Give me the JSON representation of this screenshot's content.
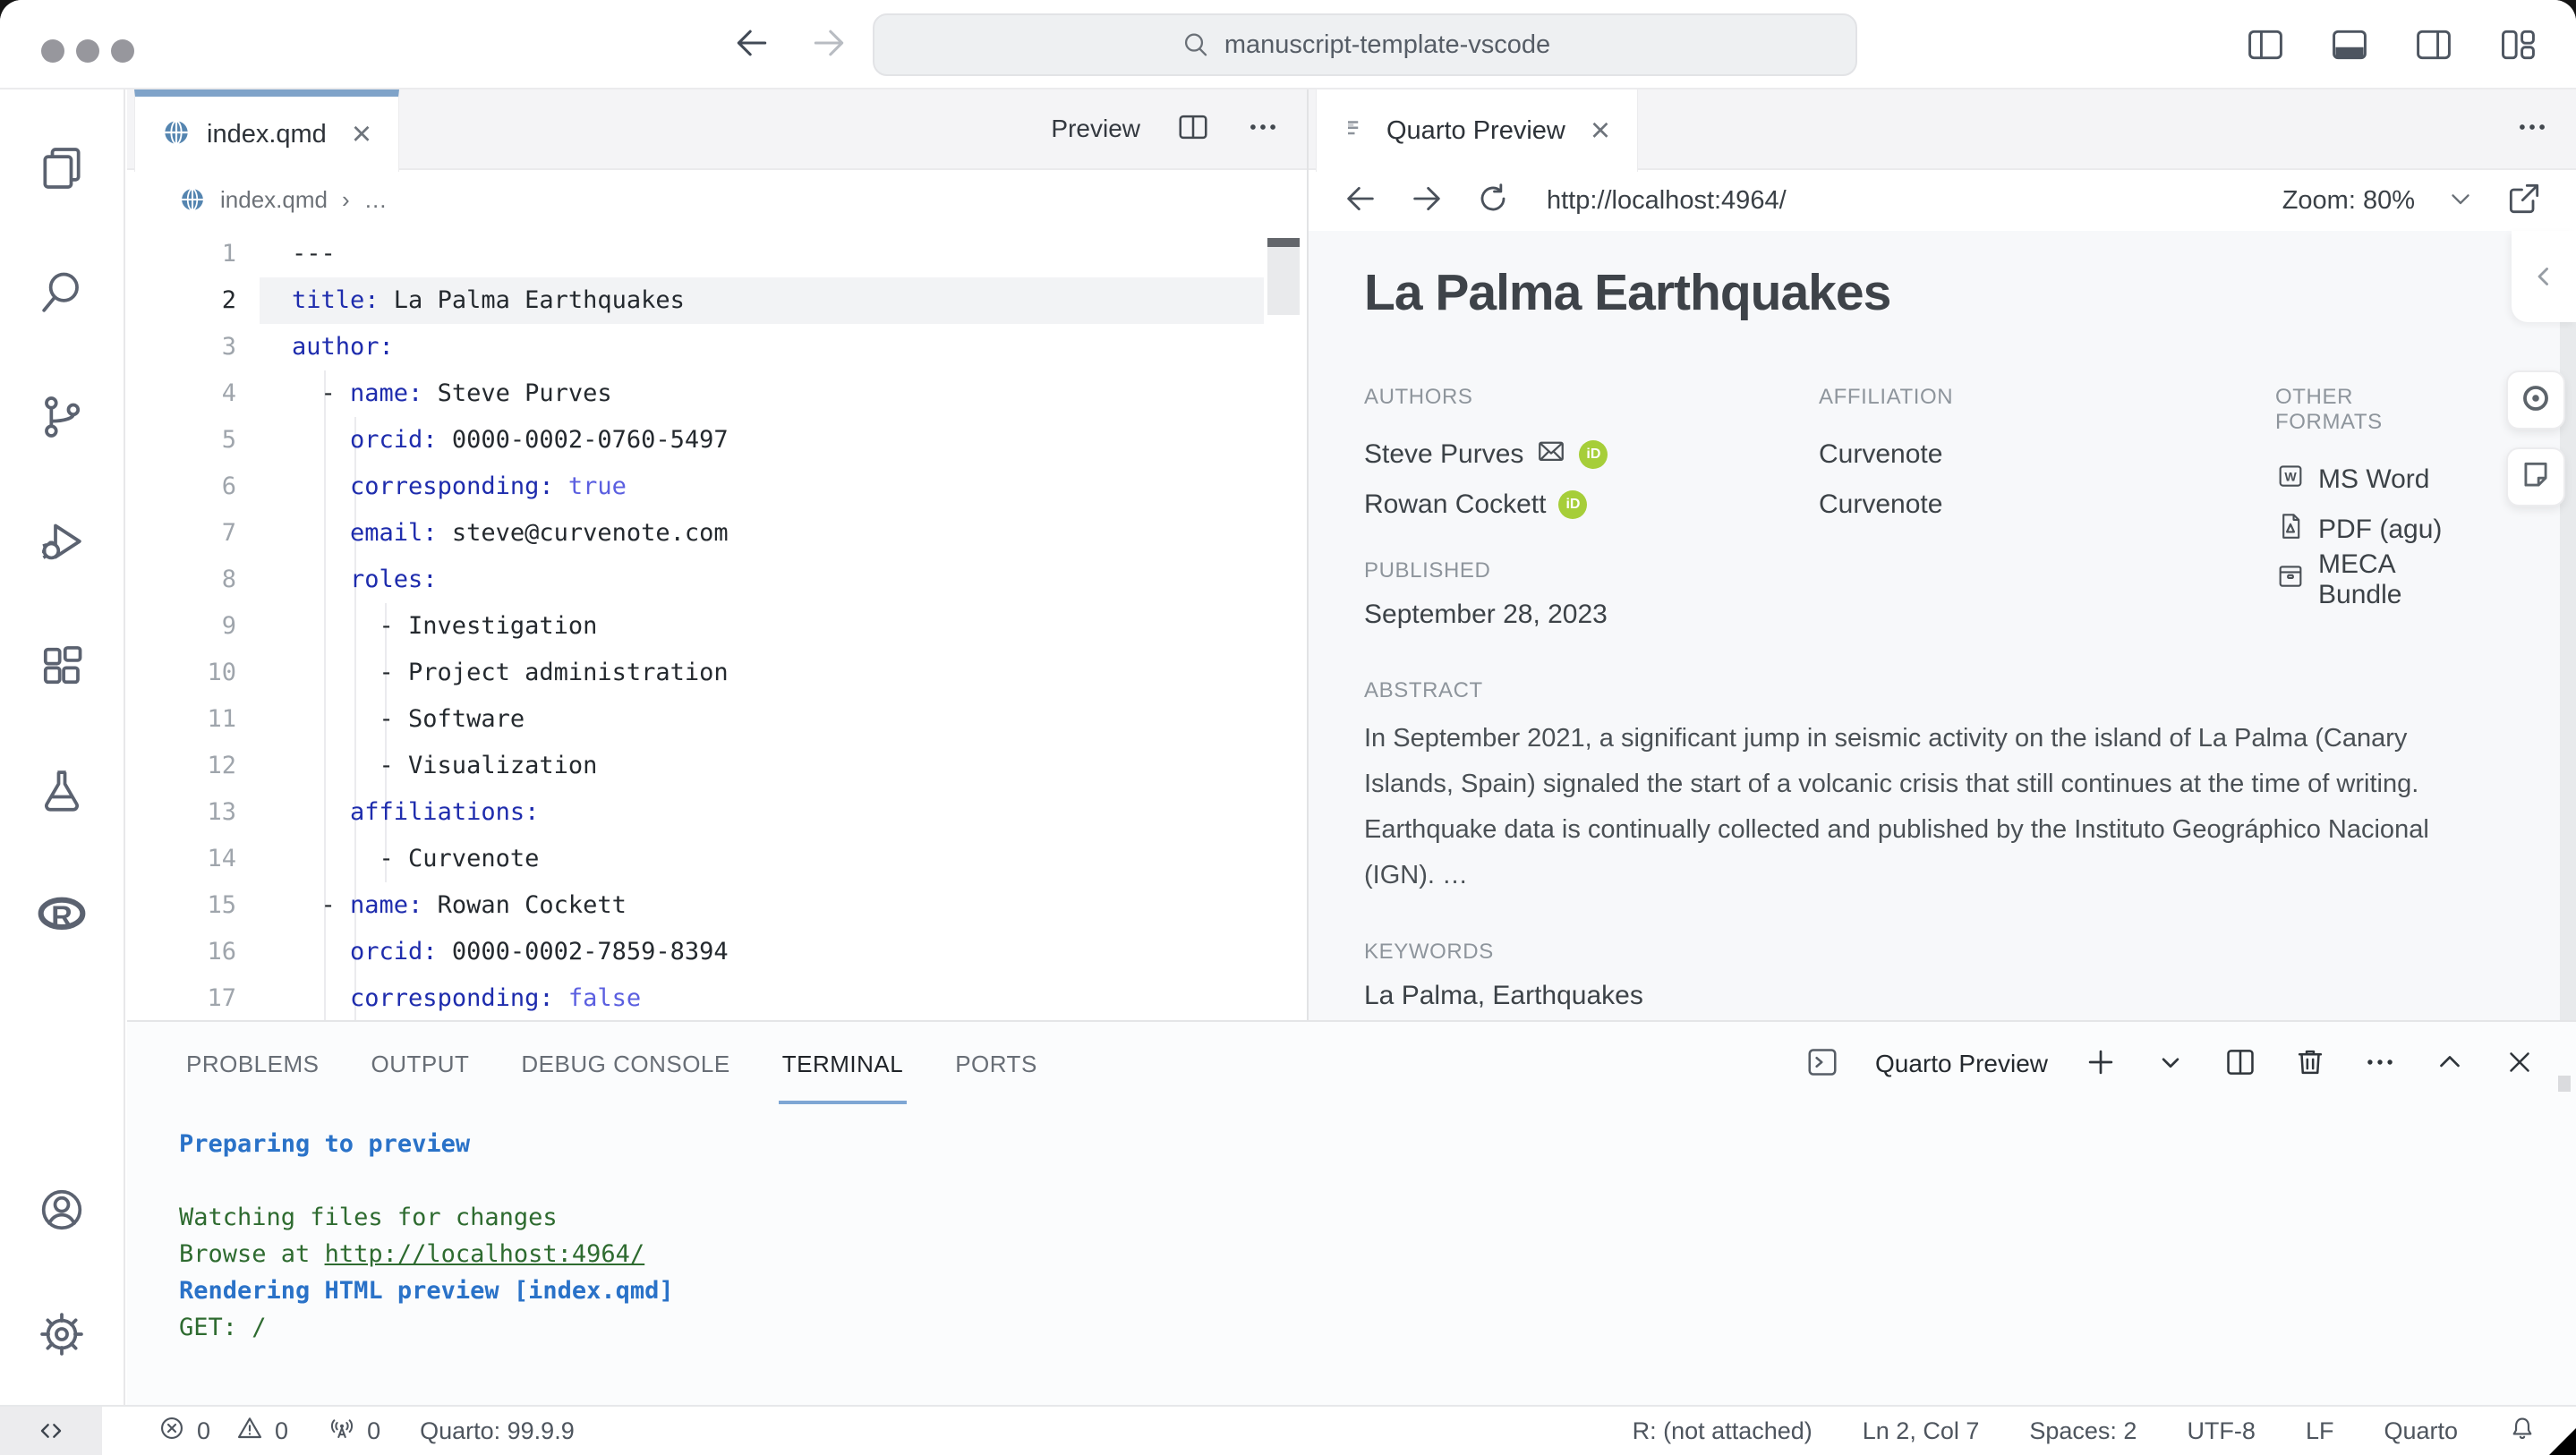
{
  "colors": {
    "accent_tab_top": "#7fa3c9",
    "key_blue": "#1e2cad",
    "bool_blue": "#5b5fe0",
    "terminal_green": "#2e6b30",
    "terminal_blue": "#2a72c8",
    "panel_tab_underline": "#7ea6d4",
    "orcid_green": "#a6ce39"
  },
  "titlebar": {
    "search_value": "manuscript-template-vscode"
  },
  "left_tab": {
    "label": "index.qmd"
  },
  "editor_actions": {
    "preview": "Preview"
  },
  "breadcrumb": {
    "file": "index.qmd",
    "sep": "›",
    "more": "…"
  },
  "code": {
    "current_line": 2,
    "lines": [
      [
        [
          "t",
          "---"
        ]
      ],
      [
        [
          "k",
          "title:"
        ],
        [
          "t",
          " La Palma Earthquakes"
        ]
      ],
      [
        [
          "k",
          "author:"
        ]
      ],
      [
        [
          "t",
          "  - "
        ],
        [
          "k",
          "name:"
        ],
        [
          "t",
          " Steve Purves"
        ]
      ],
      [
        [
          "t",
          "    "
        ],
        [
          "k",
          "orcid:"
        ],
        [
          "t",
          " 0000-0002-0760-5497"
        ]
      ],
      [
        [
          "t",
          "    "
        ],
        [
          "k",
          "corresponding:"
        ],
        [
          "t",
          " "
        ],
        [
          "b",
          "true"
        ]
      ],
      [
        [
          "t",
          "    "
        ],
        [
          "k",
          "email:"
        ],
        [
          "t",
          " steve@curvenote.com"
        ]
      ],
      [
        [
          "t",
          "    "
        ],
        [
          "k",
          "roles:"
        ]
      ],
      [
        [
          "t",
          "      - Investigation"
        ]
      ],
      [
        [
          "t",
          "      - Project administration"
        ]
      ],
      [
        [
          "t",
          "      - Software"
        ]
      ],
      [
        [
          "t",
          "      - Visualization"
        ]
      ],
      [
        [
          "t",
          "    "
        ],
        [
          "k",
          "affiliations:"
        ]
      ],
      [
        [
          "t",
          "      - Curvenote"
        ]
      ],
      [
        [
          "t",
          "  - "
        ],
        [
          "k",
          "name:"
        ],
        [
          "t",
          " Rowan Cockett"
        ]
      ],
      [
        [
          "t",
          "    "
        ],
        [
          "k",
          "orcid:"
        ],
        [
          "t",
          " 0000-0002-7859-8394"
        ]
      ],
      [
        [
          "t",
          "    "
        ],
        [
          "k",
          "corresponding:"
        ],
        [
          "t",
          " "
        ],
        [
          "b",
          "false"
        ]
      ]
    ]
  },
  "right_tab": {
    "label": "Quarto Preview"
  },
  "preview_nav": {
    "url": "http://localhost:4964/",
    "zoom": "Zoom: 80%"
  },
  "doc": {
    "title": "La Palma Earthquakes",
    "authors_label": "AUTHORS",
    "affiliation_label": "AFFILIATION",
    "formats_label": "OTHER FORMATS",
    "orcid_label": "iD",
    "authors": [
      {
        "name": "Steve Purves"
      },
      {
        "name": "Rowan Cockett"
      }
    ],
    "affiliations": [
      "Curvenote",
      "Curvenote"
    ],
    "formats": [
      "MS Word",
      "PDF (agu)",
      "MECA Bundle"
    ],
    "published_label": "PUBLISHED",
    "published": "September 28, 2023",
    "abstract_label": "ABSTRACT",
    "abstract": "In September 2021, a significant jump in seismic activity on the island of La Palma (Canary Islands, Spain) signaled the start of a volcanic crisis that still continues at the time of writing. Earthquake data is continually collected and published by the Instituto Geográphico Nacional (IGN). …",
    "keywords_label": "KEYWORDS",
    "keywords": "La Palma, Earthquakes"
  },
  "panel": {
    "tabs": [
      "PROBLEMS",
      "OUTPUT",
      "DEBUG CONSOLE",
      "TERMINAL",
      "PORTS"
    ],
    "active_tab": "TERMINAL",
    "terminal_label": "Quarto Preview",
    "terminal_lines": [
      {
        "style": "blue",
        "text": "Preparing to preview"
      },
      {
        "style": "plain",
        "text": ""
      },
      {
        "style": "green",
        "text": "Watching files for changes"
      },
      {
        "style": "green",
        "text": "Browse at ",
        "link": "http://localhost:4964/"
      },
      {
        "style": "blue",
        "text": "Rendering HTML preview [index.qmd]"
      },
      {
        "style": "green",
        "text": "GET: /"
      }
    ]
  },
  "statusbar": {
    "errors": "0",
    "warnings": "0",
    "ports": "0",
    "quarto_version": "Quarto: 99.9.9",
    "r_status": "R: (not attached)",
    "cursor": "Ln 2, Col 7",
    "indent": "Spaces: 2",
    "encoding": "UTF-8",
    "eol": "LF",
    "language": "Quarto"
  }
}
